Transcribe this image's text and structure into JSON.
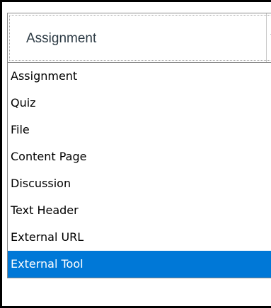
{
  "select": {
    "value": "Assignment"
  },
  "options": [
    {
      "label": "Assignment"
    },
    {
      "label": "Quiz"
    },
    {
      "label": "File"
    },
    {
      "label": "Content Page"
    },
    {
      "label": "Discussion"
    },
    {
      "label": "Text Header"
    },
    {
      "label": "External URL"
    },
    {
      "label": "External Tool"
    }
  ],
  "highlighted_option": "External Tool",
  "colors": {
    "highlight": "#0078d7",
    "highlight_text": "#ffffff",
    "option_text": "#000000",
    "select_text": "#2d3b45"
  },
  "icons": {
    "dropdown": "chevron-down-icon"
  }
}
